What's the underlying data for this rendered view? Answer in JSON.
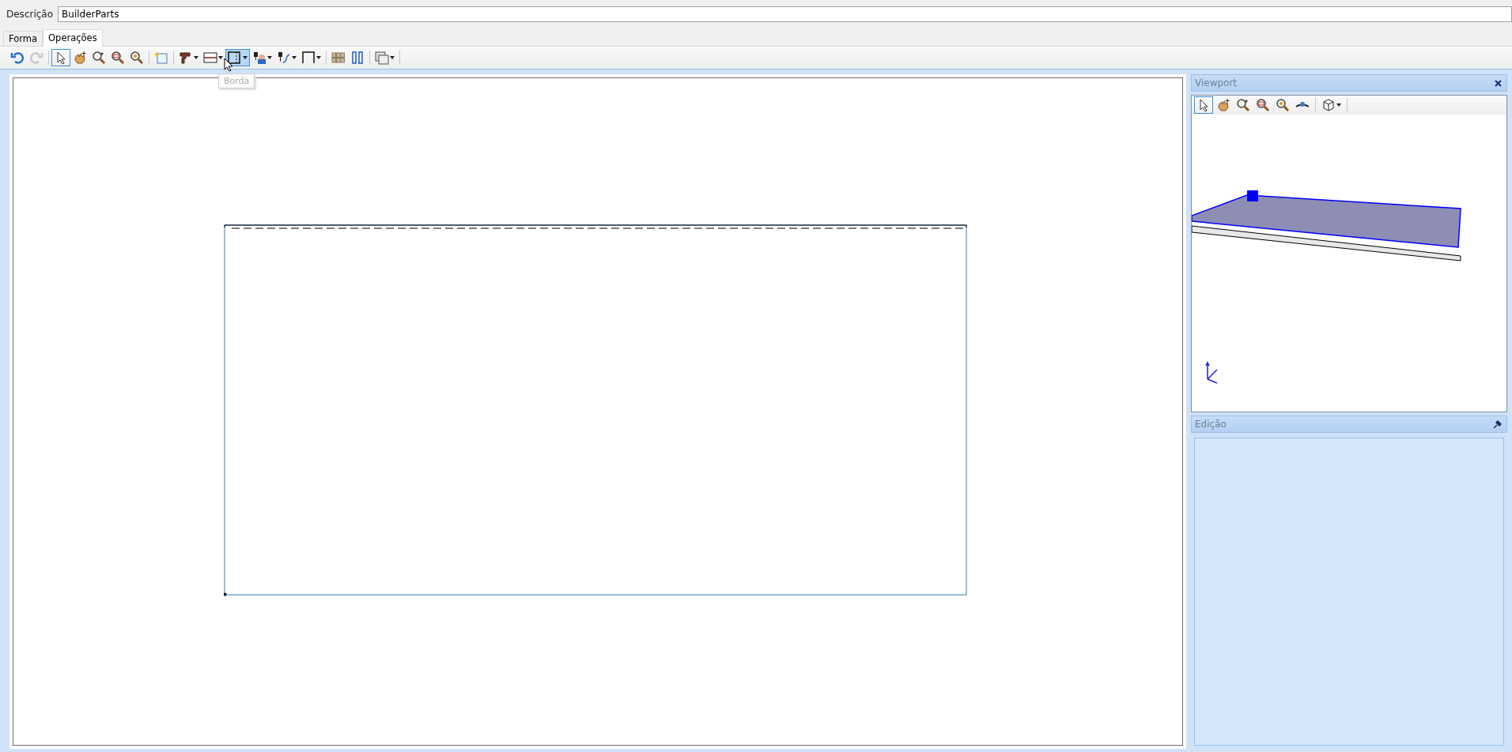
{
  "description": {
    "label": "Descrição",
    "value": "BuilderParts"
  },
  "tabs": [
    {
      "label": "Forma",
      "selected": false
    },
    {
      "label": "Operações",
      "selected": true
    }
  ],
  "toolbar": [
    {
      "kind": "tool",
      "disabled": false,
      "selected": false,
      "dropdown": false
    },
    {
      "kind": "tool",
      "disabled": true,
      "selected": false,
      "dropdown": false
    },
    {
      "kind": "separator"
    },
    {
      "kind": "tool",
      "disabled": false,
      "selected": true,
      "dropdown": false
    },
    {
      "kind": "tool",
      "disabled": false,
      "selected": false,
      "dropdown": false
    },
    {
      "kind": "tool",
      "disabled": false,
      "selected": false,
      "dropdown": false
    },
    {
      "kind": "tool",
      "disabled": false,
      "selected": false,
      "dropdown": false
    },
    {
      "kind": "tool",
      "disabled": false,
      "selected": false,
      "dropdown": false
    },
    {
      "kind": "separator"
    },
    {
      "kind": "tool",
      "disabled": false,
      "selected": false,
      "dropdown": false
    },
    {
      "kind": "separator"
    },
    {
      "kind": "tool",
      "disabled": false,
      "selected": false,
      "dropdown": true
    },
    {
      "kind": "tool",
      "disabled": false,
      "selected": false,
      "dropdown": true
    },
    {
      "kind": "tool",
      "disabled": false,
      "selected": true,
      "dropdown": true
    },
    {
      "kind": "tool",
      "disabled": false,
      "selected": false,
      "dropdown": true
    },
    {
      "kind": "tool",
      "disabled": false,
      "selected": false,
      "dropdown": true
    },
    {
      "kind": "tool",
      "disabled": false,
      "selected": false,
      "dropdown": true
    },
    {
      "kind": "separator"
    },
    {
      "kind": "tool",
      "disabled": false,
      "selected": false,
      "dropdown": false
    },
    {
      "kind": "tool",
      "disabled": false,
      "selected": false,
      "dropdown": false
    },
    {
      "kind": "separator"
    },
    {
      "kind": "tool",
      "disabled": false,
      "selected": false,
      "dropdown": true
    },
    {
      "kind": "separator"
    }
  ],
  "tooltip": {
    "text": "Borda"
  },
  "viewport": {
    "title": "Viewport",
    "toolbar": [
      {
        "kind": "tool",
        "selected": true,
        "dropdown": false
      },
      {
        "kind": "tool",
        "selected": false,
        "dropdown": false
      },
      {
        "kind": "tool",
        "selected": false,
        "dropdown": false
      },
      {
        "kind": "tool",
        "selected": false,
        "dropdown": false
      },
      {
        "kind": "tool",
        "selected": false,
        "dropdown": false
      },
      {
        "kind": "tool",
        "selected": false,
        "dropdown": false
      },
      {
        "kind": "separator"
      },
      {
        "kind": "tool",
        "selected": false,
        "dropdown": true
      },
      {
        "kind": "separator"
      }
    ]
  },
  "edition": {
    "title": "Edição"
  }
}
